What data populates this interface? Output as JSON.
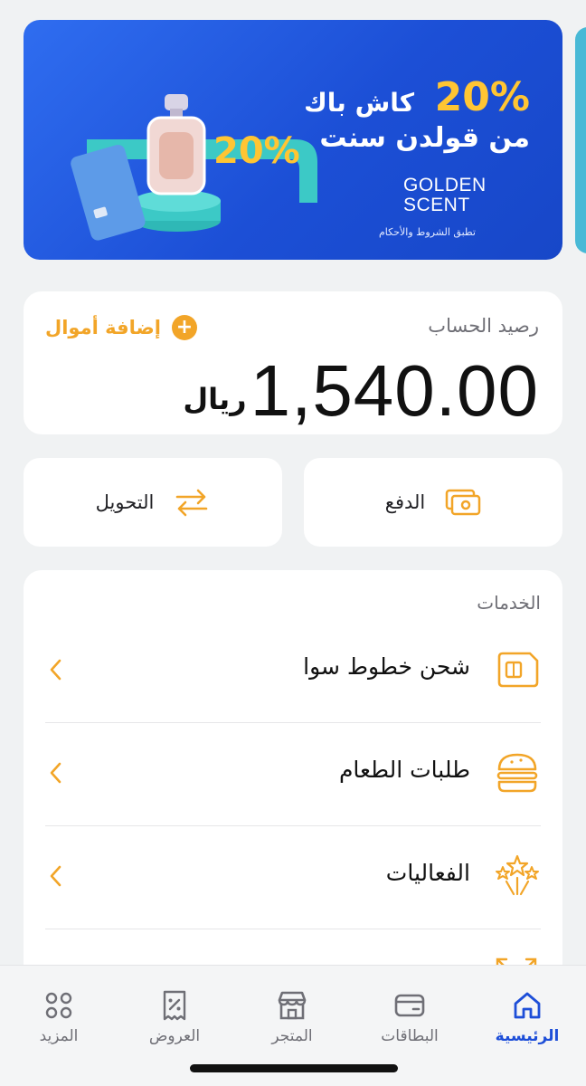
{
  "banner": {
    "percent": "20%",
    "line1": "كاش باك",
    "line2": "من قولدن سنت",
    "brand_line1": "GOLDEN",
    "brand_line2": "SCENT",
    "art_percent": "20%",
    "terms": "تطبق الشروط والأحكام"
  },
  "balance": {
    "label": "رصيد الحساب",
    "amount": "1,540.00",
    "currency": "ريال",
    "add_funds_label": "إضافة أموال",
    "add_funds_icon": "plus-circle-icon"
  },
  "actions": {
    "pay_label": "الدفع",
    "pay_icon": "cash-icon",
    "transfer_label": "التحويل",
    "transfer_icon": "transfer-arrows-icon"
  },
  "services": {
    "title": "الخدمات",
    "items": [
      {
        "label": "شحن خطوط سوا",
        "icon": "sim-card-icon"
      },
      {
        "label": "طلبات الطعام",
        "icon": "burger-icon"
      },
      {
        "label": "الفعاليات",
        "icon": "fireworks-icon"
      }
    ]
  },
  "nav": {
    "items": [
      {
        "label": "الرئيسية",
        "icon": "home-icon",
        "active": true
      },
      {
        "label": "البطاقات",
        "icon": "card-icon",
        "active": false
      },
      {
        "label": "المتجر",
        "icon": "store-icon",
        "active": false
      },
      {
        "label": "العروض",
        "icon": "offers-icon",
        "active": false
      },
      {
        "label": "المزيد",
        "icon": "more-icon",
        "active": false
      }
    ]
  },
  "colors": {
    "accent_orange": "#f2a528",
    "active_blue": "#1d4ed8",
    "banner_blue": "#1f55dc",
    "banner_yellow": "#ffc533"
  }
}
